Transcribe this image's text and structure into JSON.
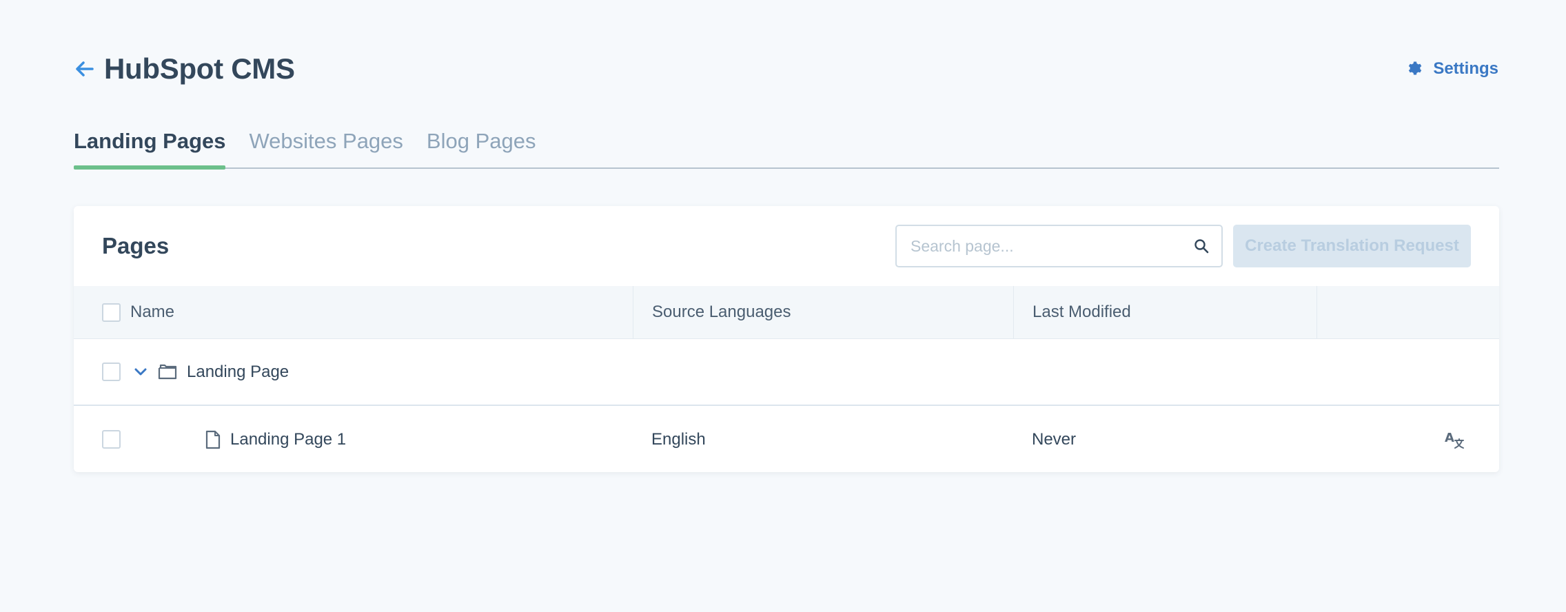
{
  "header": {
    "title": "HubSpot CMS",
    "settings_label": "Settings"
  },
  "tabs": [
    {
      "label": "Landing Pages",
      "active": true
    },
    {
      "label": "Websites Pages",
      "active": false
    },
    {
      "label": "Blog Pages",
      "active": false
    }
  ],
  "card": {
    "title": "Pages",
    "search_placeholder": "Search page...",
    "create_button": "Create Translation Request"
  },
  "table": {
    "columns": [
      "Name",
      "Source Languages",
      "Last Modified",
      ""
    ],
    "rows": [
      {
        "type": "folder",
        "name": "Landing Page",
        "source_language": "",
        "last_modified": ""
      },
      {
        "type": "page",
        "name": "Landing Page 1",
        "source_language": "English",
        "last_modified": "Never"
      }
    ]
  },
  "icons": {
    "back": "arrow-left-icon",
    "settings": "gear-icon",
    "search": "search-icon",
    "expand": "chevron-down-icon",
    "folder": "folder-icon",
    "file": "file-icon",
    "translate": "translate-icon"
  },
  "colors": {
    "accent": "#3a78c4",
    "tab_indicator": "#6cc08b",
    "background": "#f6f9fc"
  }
}
